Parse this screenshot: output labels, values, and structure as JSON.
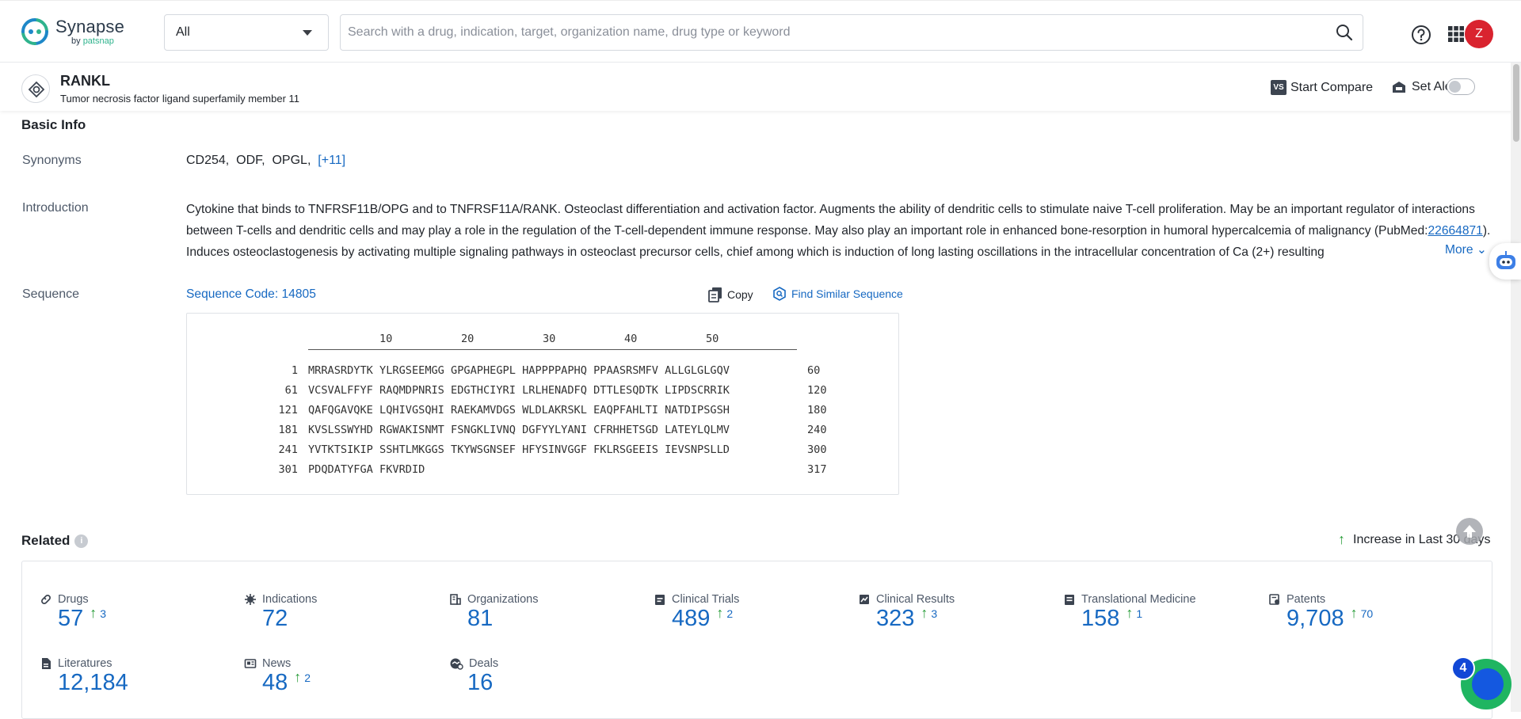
{
  "app": {
    "brand": "Synapse",
    "brand_sub_prefix": "by",
    "brand_sub": "patsnap"
  },
  "search": {
    "scope_value": "All",
    "placeholder": "Search with a drug, indication, target, organization name, drug type or keyword",
    "value": ""
  },
  "user": {
    "avatar_initial": "Z"
  },
  "target": {
    "name": "RANKL",
    "full_name": "Tumor necrosis factor ligand superfamily member 11",
    "compare_badge": "VS",
    "compare_label": "Start Compare",
    "alert_label": "Set Alert",
    "alert_enabled": false
  },
  "basic_info": {
    "title": "Basic Info",
    "synonyms_label": "Synonyms",
    "synonyms": [
      "CD254,",
      "ODF,",
      "OPGL,"
    ],
    "synonyms_more": "[+11]",
    "introduction_label": "Introduction",
    "introduction_part1": "Cytokine that binds to TNFRSF11B/OPG and to TNFRSF11A/RANK. Osteoclast differentiation and activation factor. Augments the ability of dendritic cells to stimulate naive T-cell proliferation. May be an important regulator of interactions between T-cells and dendritic cells and may play a role in the regulation of the T-cell-dependent immune response. May also play an important role in enhanced bone-resorption in humoral hypercalcemia of malignancy (PubMed:",
    "introduction_link": "22664871",
    "introduction_part2": "). Induces osteoclastogenesis by activating multiple signaling pathways in osteoclast precursor cells, chief among which is induction of long lasting oscillations in the intracellular concentration of Ca (2+) resulting",
    "introduction_more": "More",
    "sequence_label": "Sequence",
    "sequence_code": "Sequence Code: 14805",
    "copy_label": "Copy",
    "find_similar_label": "Find Similar Sequence",
    "ruler": [
      "10",
      "20",
      "30",
      "40",
      "50"
    ],
    "sequence_rows": [
      {
        "start": "1",
        "seq": "MRRASRDYTK YLRGSEEMGG GPGAPHEGPL HAPPPPAPHQ PPAASRSMFV ALLGLGLGQV",
        "end": "60"
      },
      {
        "start": "61",
        "seq": "VCSVALFFYF RAQMDPNRIS EDGTHCIYRI LRLHENADFQ DTTLESQDTK LIPDSCRRIK",
        "end": "120"
      },
      {
        "start": "121",
        "seq": "QAFQGAVQKE LQHIVGSQHI RAEKAMVDGS WLDLAKRSKL EAQPFAHLTI NATDIPSGSH",
        "end": "180"
      },
      {
        "start": "181",
        "seq": "KVSLSSWYHD RGWAKISNMT FSNGKLIVNQ DGFYYLYANI CFRHHETSGD LATEYLQLMV",
        "end": "240"
      },
      {
        "start": "241",
        "seq": "YVTKTSIKIP SSHTLMKGGS TKYWSGNSEF HFYSINVGGF FKLRSGEEIS IEVSNPSLLD",
        "end": "300"
      },
      {
        "start": "301",
        "seq": "PDQDATYFGA FKVRDID",
        "end": "317"
      }
    ]
  },
  "related": {
    "title": "Related",
    "info_glyph": "i",
    "legend": "Increase in Last 30 days",
    "legend_arrow": "↑",
    "stats": [
      {
        "name": "Drugs",
        "icon": "pill-icon",
        "value": "57",
        "increase": "3"
      },
      {
        "name": "Indications",
        "icon": "virus-icon",
        "value": "72",
        "increase": ""
      },
      {
        "name": "Organizations",
        "icon": "building-icon",
        "value": "81",
        "increase": ""
      },
      {
        "name": "Clinical Trials",
        "icon": "clipboard-icon",
        "value": "489",
        "increase": "2"
      },
      {
        "name": "Clinical Results",
        "icon": "chart-icon",
        "value": "323",
        "increase": "3"
      },
      {
        "name": "Translational Medicine",
        "icon": "book-icon",
        "value": "158",
        "increase": "1"
      },
      {
        "name": "Patents",
        "icon": "patent-icon",
        "value": "9,708",
        "increase": "70"
      },
      {
        "name": "Literatures",
        "icon": "document-icon",
        "value": "12,184",
        "increase": ""
      },
      {
        "name": "News",
        "icon": "newspaper-icon",
        "value": "48",
        "increase": "2"
      },
      {
        "name": "Deals",
        "icon": "handshake-icon",
        "value": "16",
        "increase": ""
      }
    ]
  },
  "chat": {
    "badge_count": "4"
  },
  "colors": {
    "accent": "#1769c2",
    "increase": "#2a9d3a",
    "avatar": "#d9232f",
    "chat": "#1fb561"
  }
}
